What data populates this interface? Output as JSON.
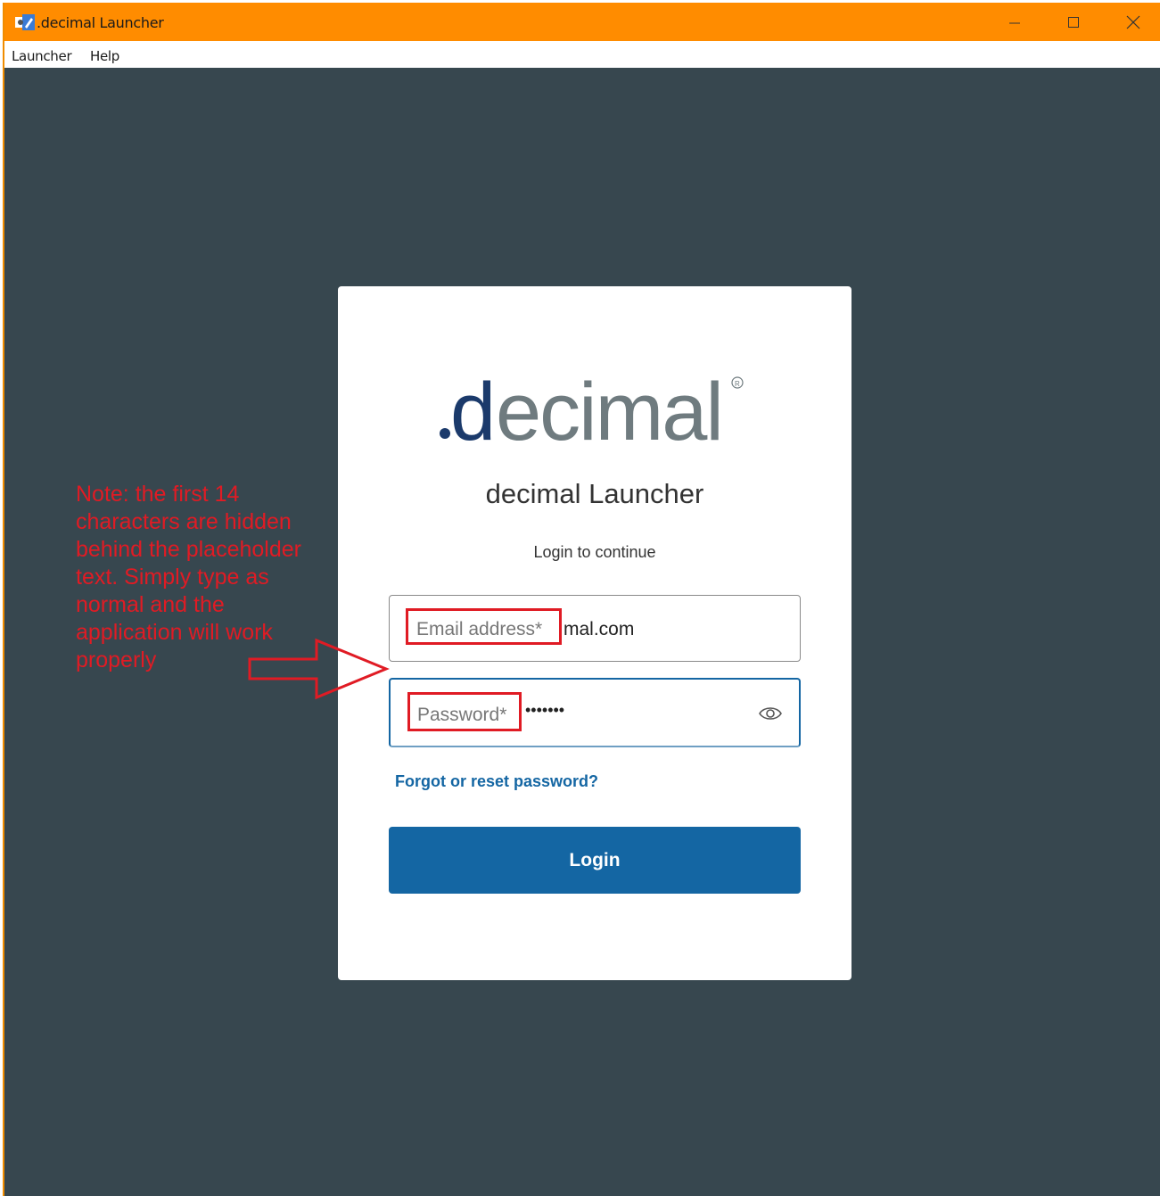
{
  "window": {
    "title": ".decimal Launcher",
    "controls": [
      "minimize",
      "maximize",
      "close"
    ]
  },
  "menubar": {
    "items": [
      "Launcher",
      "Help"
    ]
  },
  "login": {
    "title": "decimal Launcher",
    "subtitle": "Login to continue",
    "email_label": "Email address*",
    "email_value": "mal.com",
    "password_label": "Password*",
    "password_value": "•••••••",
    "forgot_link": "Forgot or reset password?",
    "login_button": "Login"
  },
  "annotation": {
    "note": "Note: the first 14 characters are hidden behind the placeholder text. Simply type as normal and the application will work properly",
    "color": "#e01b24"
  },
  "colors": {
    "titlebar": "#ff8c00",
    "background": "#37474f",
    "brand": "#1466a3",
    "logo_dark": "#1b3a6b",
    "logo_grey": "#6f7b7f"
  }
}
